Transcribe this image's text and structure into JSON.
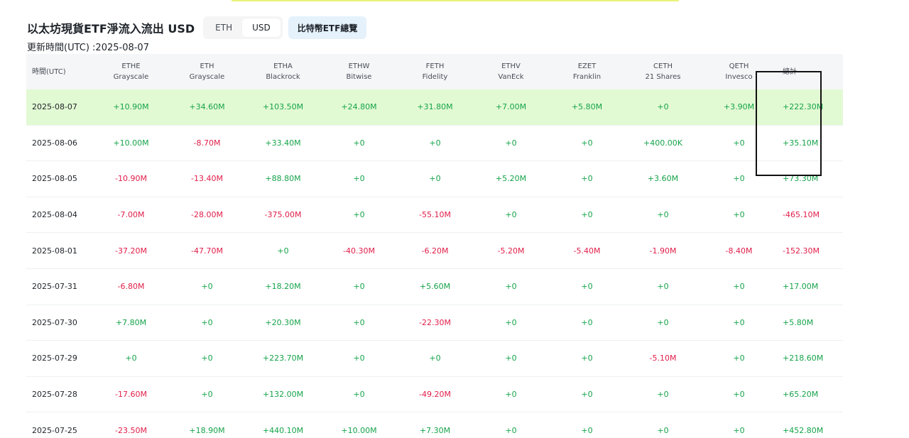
{
  "page": {
    "title": "以太坊現貨ETF淨流入流出 USD",
    "updated": "更新時間(UTC) :2025-08-07",
    "toggle": {
      "opt_eth": "ETH",
      "opt_usd": "USD"
    },
    "btc_button": "比特幣ETF總覽"
  },
  "table": {
    "columns": [
      {
        "ticker": "時間(UTC)",
        "issuer": ""
      },
      {
        "ticker": "ETHE",
        "issuer": "Grayscale"
      },
      {
        "ticker": "ETH",
        "issuer": "Grayscale"
      },
      {
        "ticker": "ETHA",
        "issuer": "Blackrock"
      },
      {
        "ticker": "ETHW",
        "issuer": "Bitwise"
      },
      {
        "ticker": "FETH",
        "issuer": "Fidelity"
      },
      {
        "ticker": "ETHV",
        "issuer": "VanEck"
      },
      {
        "ticker": "EZET",
        "issuer": "Franklin"
      },
      {
        "ticker": "CETH",
        "issuer": "21 Shares"
      },
      {
        "ticker": "QETH",
        "issuer": "Invesco"
      },
      {
        "ticker": "總計",
        "issuer": ""
      }
    ],
    "rows": [
      {
        "date": "2025-08-07",
        "values": [
          "+10.90M",
          "+34.60M",
          "+103.50M",
          "+24.80M",
          "+31.80M",
          "+7.00M",
          "+5.80M",
          "+0",
          "+3.90M",
          "+222.30M"
        ]
      },
      {
        "date": "2025-08-06",
        "values": [
          "+10.00M",
          "-8.70M",
          "+33.40M",
          "+0",
          "+0",
          "+0",
          "+0",
          "+400.00K",
          "+0",
          "+35.10M"
        ]
      },
      {
        "date": "2025-08-05",
        "values": [
          "-10.90M",
          "-13.40M",
          "+88.80M",
          "+0",
          "+0",
          "+5.20M",
          "+0",
          "+3.60M",
          "+0",
          "+73.30M"
        ]
      },
      {
        "date": "2025-08-04",
        "values": [
          "-7.00M",
          "-28.00M",
          "-375.00M",
          "+0",
          "-55.10M",
          "+0",
          "+0",
          "+0",
          "+0",
          "-465.10M"
        ]
      },
      {
        "date": "2025-08-01",
        "values": [
          "-37.20M",
          "-47.70M",
          "+0",
          "-40.30M",
          "-6.20M",
          "-5.20M",
          "-5.40M",
          "-1.90M",
          "-8.40M",
          "-152.30M"
        ]
      },
      {
        "date": "2025-07-31",
        "values": [
          "-6.80M",
          "+0",
          "+18.20M",
          "+0",
          "+5.60M",
          "+0",
          "+0",
          "+0",
          "+0",
          "+17.00M"
        ]
      },
      {
        "date": "2025-07-30",
        "values": [
          "+7.80M",
          "+0",
          "+20.30M",
          "+0",
          "-22.30M",
          "+0",
          "+0",
          "+0",
          "+0",
          "+5.80M"
        ]
      },
      {
        "date": "2025-07-29",
        "values": [
          "+0",
          "+0",
          "+223.70M",
          "+0",
          "+0",
          "+0",
          "+0",
          "-5.10M",
          "+0",
          "+218.60M"
        ]
      },
      {
        "date": "2025-07-28",
        "values": [
          "-17.60M",
          "+0",
          "+132.00M",
          "+0",
          "-49.20M",
          "+0",
          "+0",
          "+0",
          "+0",
          "+65.20M"
        ]
      },
      {
        "date": "2025-07-25",
        "values": [
          "-23.50M",
          "+18.90M",
          "+440.10M",
          "+10.00M",
          "+7.30M",
          "+0",
          "+0",
          "+0",
          "+0",
          "+452.80M"
        ]
      }
    ]
  },
  "colors": {
    "positive": "#16a34a",
    "negative": "#e11d48",
    "highlight_row": "#e2fad3",
    "header_bg": "#f5f6f7"
  }
}
